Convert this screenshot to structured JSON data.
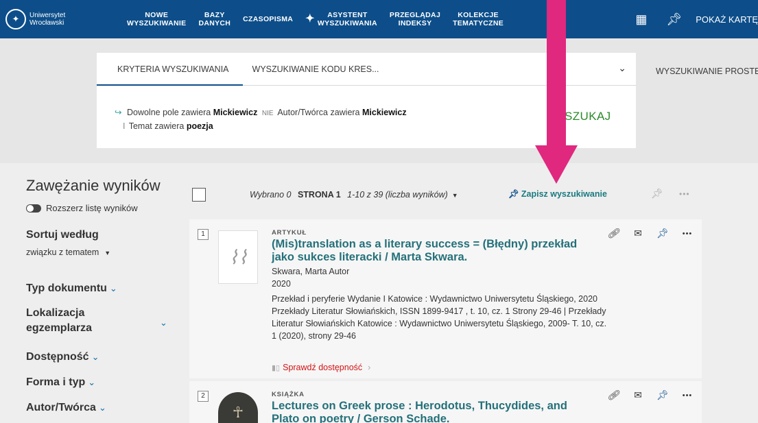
{
  "topbar": {
    "logo_line1": "Uniwersytet",
    "logo_line2": "Wrocławski",
    "nav": [
      {
        "label": "NOWE\nWYSZUKIWANIE"
      },
      {
        "label": "BAZY\nDANYCH"
      },
      {
        "label": "CZASOPISMA"
      },
      {
        "label": "ASYSTENT\nWYSZUKIWANIA"
      },
      {
        "label": "PRZEGLĄDAJ\nINDEKSY"
      },
      {
        "label": "KOLEKCJE\nTEMATYCZNE"
      }
    ],
    "show_card": "POKAŻ KARTĘ"
  },
  "search": {
    "tab_criteria": "KRYTERIA WYSZUKIWANIA",
    "tab_code": "WYSZUKIWANIE KODU KRES...",
    "criteria_line1_a": "Dowolne pole zawiera",
    "criteria_line1_b": "Mickiewicz",
    "criteria_nie": "NIE",
    "criteria_line1_c": "Autor/Twórca zawiera",
    "criteria_line1_d": "Mickiewicz",
    "criteria_line2_a": "Temat zawiera",
    "criteria_line2_b": "poezja",
    "search_button": "SZUKAJ",
    "simple_search": "WYSZUKIWANIE PROSTE"
  },
  "facets": {
    "title": "Zawężanie wyników",
    "expand_label": "Rozszerz listę wyników",
    "sort_heading": "Sortuj według",
    "sort_value": "związku z tematem",
    "items": [
      "Typ dokumentu",
      "Lokalizacja egzemplarza",
      "Dostępność",
      "Forma i typ",
      "Autor/Twórca"
    ]
  },
  "toolbar": {
    "selected": "Wybrano 0",
    "page": "STRONA 1",
    "range": "1-10 z 39 (liczba wyników)",
    "save_search": "Zapisz wyszukiwanie"
  },
  "results": [
    {
      "num": "1",
      "type": "ARTYKUŁ",
      "title_line1": "(Mis)translation as a literary success = (Błędny) przekład",
      "title_line2": "jako sukces literacki / Marta Skwara.",
      "author": "Skwara, Marta Autor",
      "year": "2020",
      "detail1": "Przekład i peryferie Wydanie I Katowice : Wydawnictwo Uniwersytetu Śląskiego, 2020",
      "detail2": "Przekłady Literatur Słowiańskich, ISSN 1899-9417 , t. 10, cz. 1 Strony 29-46 | Przekłady",
      "detail3": "Literatur Słowiańskich Katowice : Wydawnictwo Uniwersytetu Śląskiego, 2009- T. 10, cz.",
      "detail4": "1 (2020), strony 29-46",
      "availability": "Sprawdź dostępność"
    },
    {
      "num": "2",
      "type": "KSIĄŻKA",
      "title_line1": "Lectures on Greek prose : Herodotus, Thucydides, and",
      "title_line2": "Plato on poetry / Gerson Schade."
    }
  ],
  "icons": {
    "link": "link-icon",
    "mail": "mail-icon",
    "pin": "pin-icon",
    "more": "more-icon"
  },
  "colors": {
    "topbar": "#0d4e8a",
    "title_link": "#24707a",
    "search_button": "#2a8a2a",
    "availability": "#d21414",
    "annotation_arrow": "#e0287f"
  }
}
